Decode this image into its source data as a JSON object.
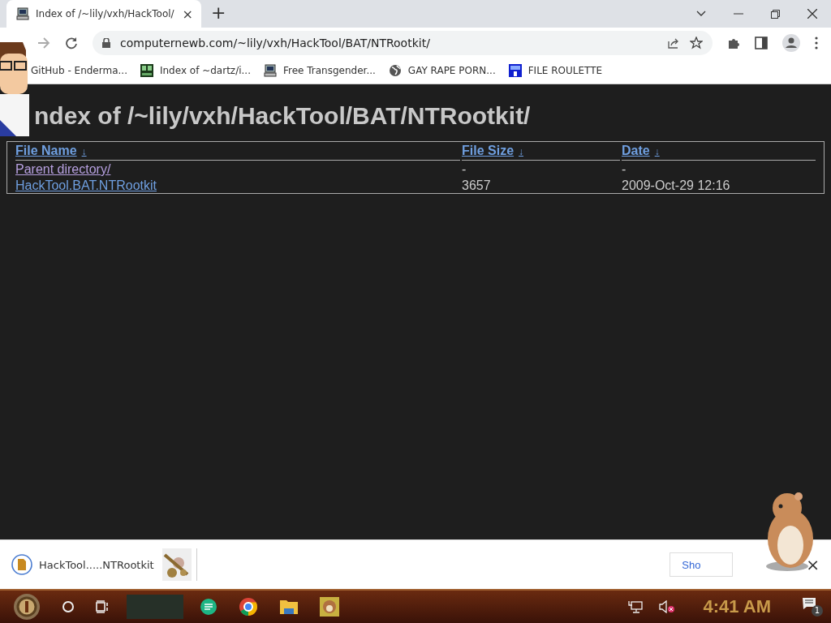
{
  "browser": {
    "tab": {
      "title": "Index of /~lily/vxh/HackTool/",
      "close": "×"
    },
    "new_tab": "+",
    "address": "computernewb.com/~lily/vxh/HackTool/BAT/NTRootkit/",
    "bookmarks": [
      {
        "label": "GitHub - Enderma...",
        "kind": "plain"
      },
      {
        "label": "Index of ~dartz/i...",
        "kind": "grid"
      },
      {
        "label": "Free Transgender...",
        "kind": "computer"
      },
      {
        "label": "GAY RAPE PORN...",
        "kind": "globe"
      },
      {
        "label": "FILE ROULETTE",
        "kind": "square"
      }
    ]
  },
  "page": {
    "heading": "ndex of /~lily/vxh/HackTool/BAT/NTRootkit/",
    "columns": [
      {
        "label": "File Name",
        "sort": "↓"
      },
      {
        "label": "File Size",
        "sort": "↓"
      },
      {
        "label": "Date",
        "sort": "↓"
      }
    ],
    "rows": [
      {
        "cells": [
          "Parent directory/",
          "-",
          "-"
        ],
        "visited": true
      },
      {
        "cells": [
          "HackTool.BAT.NTRootkit",
          "3657",
          "2009-Oct-29 12:16"
        ],
        "visited": false
      }
    ]
  },
  "downloads": {
    "item": "HackTool.....NTRootkit",
    "show_button": "Sho",
    "close": "×"
  },
  "taskbar": {
    "clock": "4:41 AM",
    "notifications": "1"
  }
}
